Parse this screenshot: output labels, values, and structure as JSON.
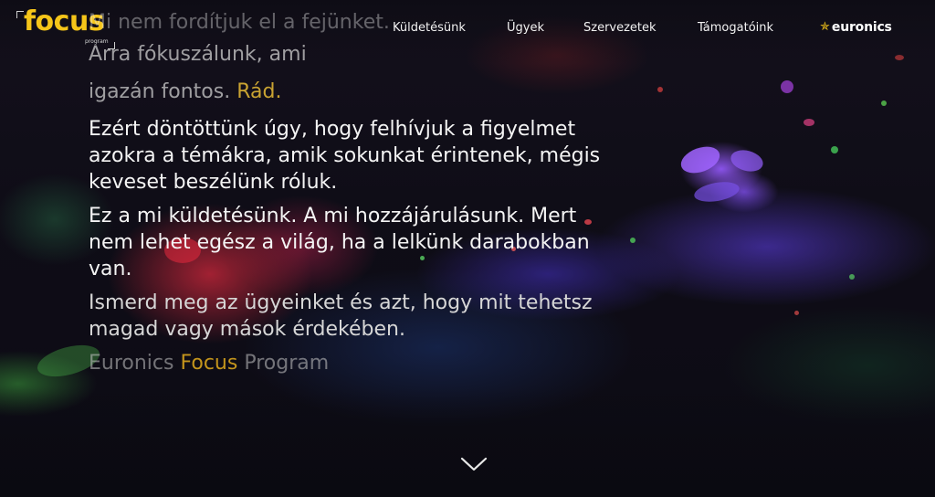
{
  "header": {
    "logo_word": "focus",
    "logo_sub": "program",
    "nav": [
      {
        "label": "Küldetésünk"
      },
      {
        "label": "Ügyek"
      },
      {
        "label": "Szervezetek"
      },
      {
        "label": "Támogatóink"
      }
    ],
    "brand": {
      "star": "✯",
      "name": "euronics"
    }
  },
  "hero": {
    "line_faded": "Mi nem fordítjuk el a fejünket.",
    "line2": "Arra fókuszálunk, ami",
    "line3_prefix": "igazán fontos. ",
    "line3_accent": "Rád.",
    "para1": "Ezért döntöttünk úgy, hogy felhívjuk a figyelmet azokra a témákra, amik sokunkat érintenek, mégis keveset beszélünk róluk.",
    "para2": "Ez a mi küldetésünk. A mi hozzájárulásunk. Mert nem lehet egész a világ, ha a lelkünk darabokban van.",
    "para3": "Ismerd meg az ügyeinket és azt, hogy mit tehetsz magad vagy mások érdekében.",
    "signature_prefix": "Euronics ",
    "signature_accent": "Focus",
    "signature_suffix": " Program"
  },
  "colors": {
    "accent_yellow": "#f5c519",
    "accent_gold": "#c9a332",
    "text": "#f4f4f4"
  },
  "icons": {
    "scroll": "chevron-down-icon"
  }
}
